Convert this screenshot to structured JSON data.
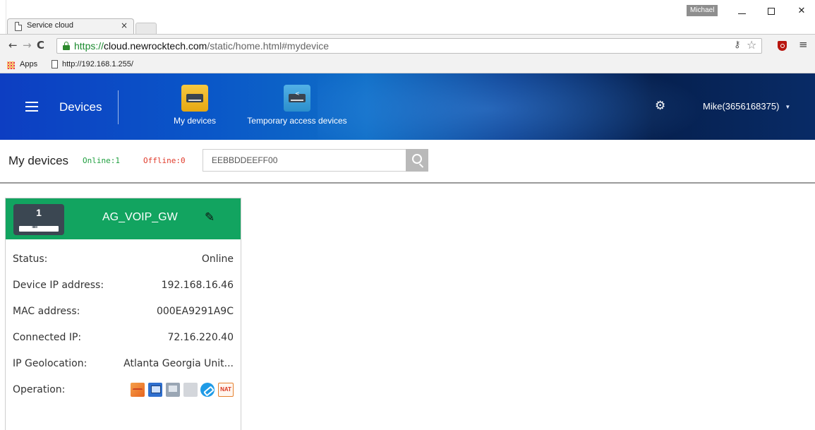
{
  "browser": {
    "tab_title": "Service cloud",
    "tab_close": "×",
    "profile_name": "Michael",
    "url_scheme": "https://",
    "url_host": "cloud.newrocktech.com",
    "url_path": "/static/home.html#mydevice",
    "bookmarks": {
      "apps_label": "Apps",
      "bookmark_1": "http://192.168.1.255/"
    },
    "icons": [
      "back-icon",
      "forward-icon",
      "reload-icon",
      "lock-icon",
      "key-icon",
      "star-icon",
      "ublock-icon",
      "menu-icon"
    ]
  },
  "header": {
    "title": "Devices",
    "nav": [
      {
        "label": "My devices"
      },
      {
        "label": "Temporary access devices"
      }
    ],
    "user": "Mike(3656168375)"
  },
  "subheader": {
    "title": "My devices",
    "online": "Online:1",
    "offline": "Offline:0",
    "search_value": "EEBBDDEEFF00"
  },
  "device_card": {
    "index": "1",
    "name": "AG_VOIP_GW",
    "rows": [
      {
        "label": "Status:",
        "value": "Online"
      },
      {
        "label": "Device IP address:",
        "value": "192.168.16.46"
      },
      {
        "label": "MAC address:",
        "value": "000EA9291A9C"
      },
      {
        "label": "Connected IP:",
        "value": "72.16.220.40"
      },
      {
        "label": "IP Geolocation:",
        "value": "Atlanta Georgia Unit..."
      }
    ],
    "operation_label": "Operation:",
    "operations": [
      "monitor-icon",
      "remote-desktop-icon",
      "web-console-icon",
      "link-icon",
      "tunnel-icon",
      "NAT"
    ]
  },
  "colors": {
    "header_start": "#0d3ec2",
    "header_end": "#082b66",
    "card_head": "#12a460",
    "online": "#1f9f3f",
    "offline": "#e03b2b"
  }
}
